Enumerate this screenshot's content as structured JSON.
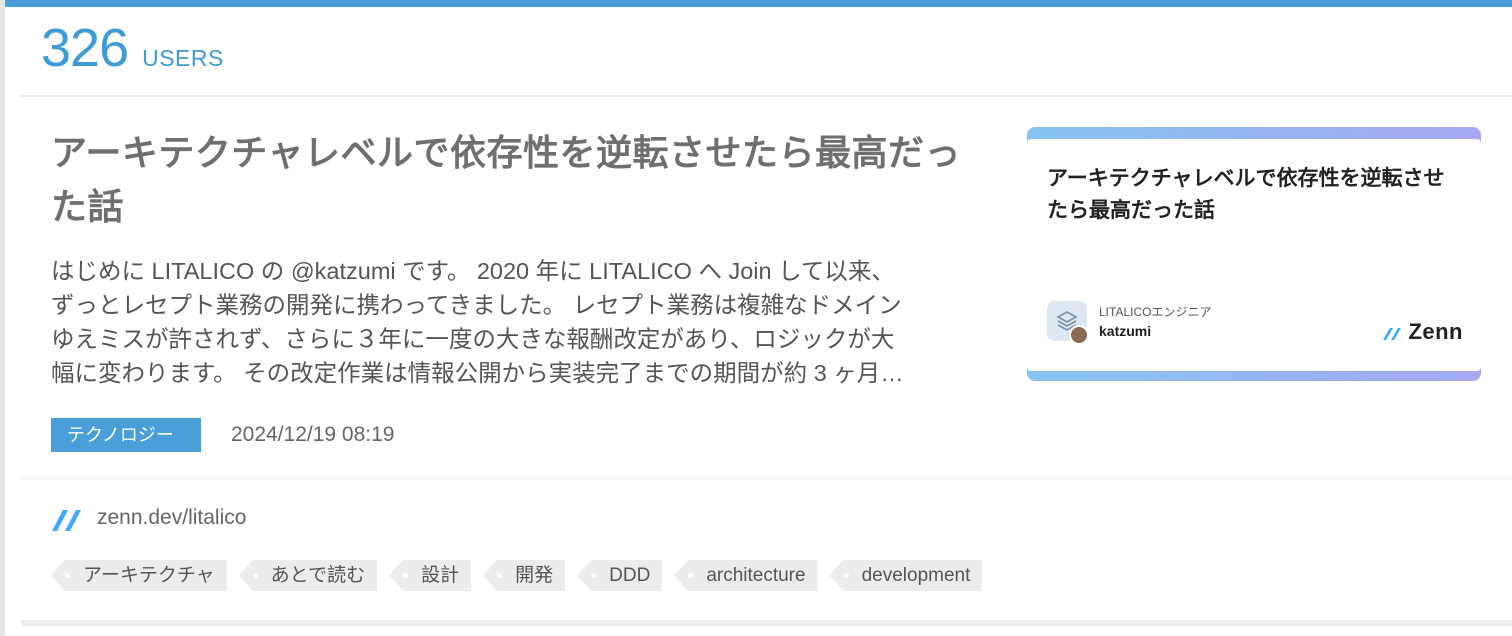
{
  "colors": {
    "accent": "#4a9fd8",
    "users_text": "#3d9bd6",
    "title_text": "#6f6f6f",
    "tag_bg": "#ececec"
  },
  "entry": {
    "users_count": "326",
    "users_label": "USERS",
    "title": "アーキテクチャレベルで依存性を逆転させたら最高だった話",
    "summary": "はじめに LITALICO の @katzumi です。 2020 年に LITALICO へ Join して以来、\nずっとレセプト業務の開発に携わってきました。 レセプト業務は複雑なドメイン\nゆえミスが許されず、さらに３年に一度の大きな報酬改定があり、ロジックが大\n幅に変わります。 その改定作業は情報公開から実装完了までの期間が約 3 ヶ月…",
    "category": "テクノロジー",
    "date": "2024/12/19 08:19",
    "source_icon": "zenn-logo-icon",
    "source": "zenn.dev/litalico"
  },
  "thumbnail": {
    "title": "アーキテクチャレベルで依存性を逆転させたら最高だった話",
    "org_name": "LITALICOエンジニア",
    "author": "katzumi",
    "brand": "Zenn"
  },
  "tags": [
    "アーキテクチャ",
    "あとで読む",
    "設計",
    "開発",
    "DDD",
    "architecture",
    "development"
  ]
}
